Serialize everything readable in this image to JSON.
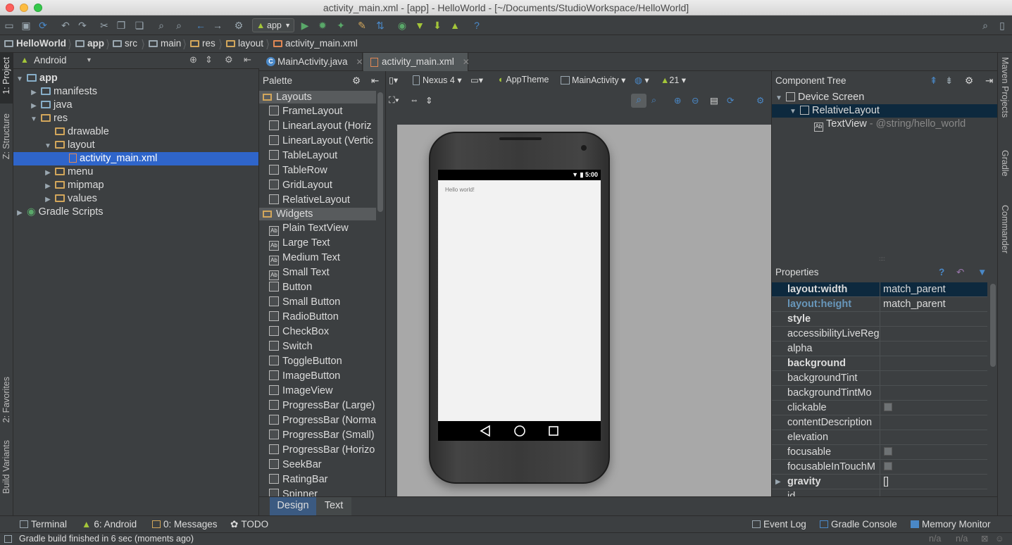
{
  "window": {
    "title": "activity_main.xml - [app] - HelloWorld - [~/Documents/StudioWorkspace/HelloWorld]"
  },
  "toolbar": {
    "run_config": "app"
  },
  "breadcrumbs": [
    "HelloWorld",
    "app",
    "src",
    "main",
    "res",
    "layout",
    "activity_main.xml"
  ],
  "left_strip": {
    "project": "1: Project",
    "structure": "Z: Structure",
    "favorites": "2: Favorites",
    "build_variants": "Build Variants"
  },
  "right_strip": {
    "maven": "Maven Projects",
    "gradle": "Gradle",
    "commander": "Commander"
  },
  "project": {
    "view": "Android",
    "tree": [
      {
        "label": "app",
        "depth": 0,
        "expanded": true,
        "type": "module"
      },
      {
        "label": "manifests",
        "depth": 1,
        "expanded": false,
        "type": "folder"
      },
      {
        "label": "java",
        "depth": 1,
        "expanded": false,
        "type": "folder"
      },
      {
        "label": "res",
        "depth": 1,
        "expanded": true,
        "type": "res"
      },
      {
        "label": "drawable",
        "depth": 2,
        "expanded": null,
        "type": "res"
      },
      {
        "label": "layout",
        "depth": 2,
        "expanded": true,
        "type": "res"
      },
      {
        "label": "activity_main.xml",
        "depth": 3,
        "expanded": null,
        "type": "xml",
        "selected": true
      },
      {
        "label": "menu",
        "depth": 2,
        "expanded": false,
        "type": "res"
      },
      {
        "label": "mipmap",
        "depth": 2,
        "expanded": false,
        "type": "res"
      },
      {
        "label": "values",
        "depth": 2,
        "expanded": false,
        "type": "res"
      },
      {
        "label": "Gradle Scripts",
        "depth": 0,
        "expanded": false,
        "type": "gradle"
      }
    ]
  },
  "editor_tabs": [
    {
      "label": "MainActivity.java",
      "active": false
    },
    {
      "label": "activity_main.xml",
      "active": true
    }
  ],
  "palette": {
    "title": "Palette",
    "groups": [
      {
        "name": "Layouts",
        "items": [
          "FrameLayout",
          "LinearLayout (Horiz",
          "LinearLayout (Vertic",
          "TableLayout",
          "TableRow",
          "GridLayout",
          "RelativeLayout"
        ]
      },
      {
        "name": "Widgets",
        "items": [
          "Plain TextView",
          "Large Text",
          "Medium Text",
          "Small Text",
          "Button",
          "Small Button",
          "RadioButton",
          "CheckBox",
          "Switch",
          "ToggleButton",
          "ImageButton",
          "ImageView",
          "ProgressBar (Large)",
          "ProgressBar (Norma",
          "ProgressBar (Small)",
          "ProgressBar (Horizo",
          "SeekBar",
          "RatingBar",
          "Spinner"
        ]
      }
    ]
  },
  "designer": {
    "device": "Nexus 4",
    "theme": "AppTheme",
    "activity": "MainActivity",
    "api": "21",
    "phone_time": "5:00",
    "preview_text": "Hello world!"
  },
  "design_tabs": [
    "Design",
    "Text"
  ],
  "component_tree": {
    "title": "Component Tree",
    "nodes": [
      {
        "label": "Device Screen",
        "depth": 0,
        "extra": ""
      },
      {
        "label": "RelativeLayout",
        "depth": 1,
        "extra": "",
        "selected": true
      },
      {
        "label": "TextView",
        "depth": 2,
        "extra": " - @string/hello_world"
      }
    ]
  },
  "properties": {
    "title": "Properties",
    "rows": [
      {
        "name": "layout:width",
        "value": "match_parent",
        "bold": true,
        "selected": true
      },
      {
        "name": "layout:height",
        "value": "match_parent",
        "bold": true,
        "link": true
      },
      {
        "name": "style",
        "value": "",
        "bold": true
      },
      {
        "name": "accessibilityLiveReg",
        "value": ""
      },
      {
        "name": "alpha",
        "value": ""
      },
      {
        "name": "background",
        "value": "",
        "bold": true
      },
      {
        "name": "backgroundTint",
        "value": ""
      },
      {
        "name": "backgroundTintMo",
        "value": ""
      },
      {
        "name": "clickable",
        "value": "",
        "checkbox": true
      },
      {
        "name": "contentDescription",
        "value": ""
      },
      {
        "name": "elevation",
        "value": ""
      },
      {
        "name": "focusable",
        "value": "",
        "checkbox": true
      },
      {
        "name": "focusableInTouchM",
        "value": "",
        "checkbox": true
      },
      {
        "name": "gravity",
        "value": "[]",
        "bold": true,
        "expandable": true
      },
      {
        "name": "id",
        "value": ""
      }
    ]
  },
  "tool_windows": {
    "left": [
      {
        "label": "Terminal"
      },
      {
        "label": "6: Android"
      },
      {
        "label": "0: Messages"
      },
      {
        "label": "TODO"
      }
    ],
    "right": [
      {
        "label": "Event Log"
      },
      {
        "label": "Gradle Console"
      },
      {
        "label": "Memory Monitor"
      }
    ]
  },
  "status": {
    "message": "Gradle build finished in 6 sec (moments ago)",
    "pos1": "n/a",
    "pos2": "n/a"
  },
  "colors": {
    "selection": "#2f65ca",
    "background": "#3c3f41",
    "accent": "#4a88c7"
  }
}
